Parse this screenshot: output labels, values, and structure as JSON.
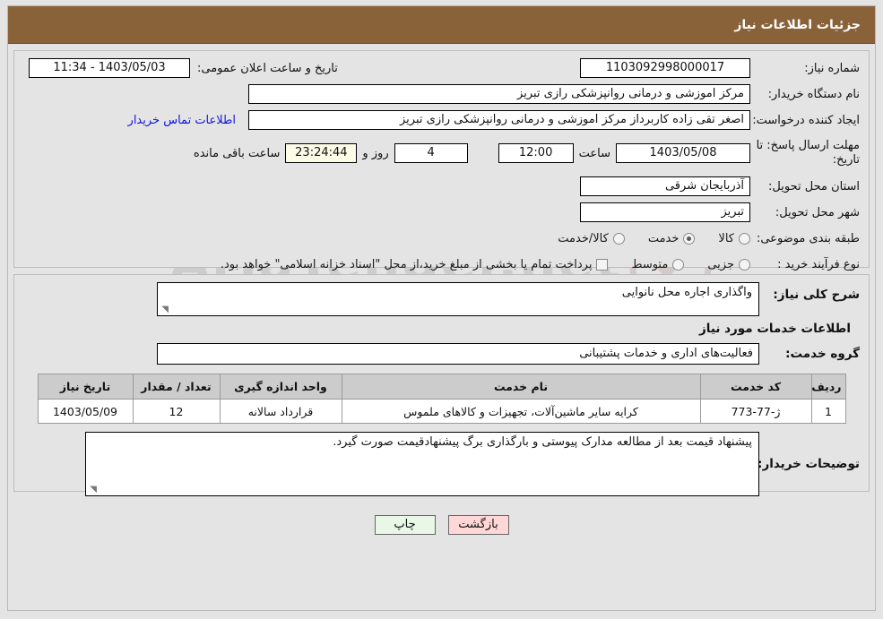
{
  "header": {
    "title": "جزئیات اطلاعات نیاز",
    "bar_color": "#8a6239"
  },
  "watermark": {
    "text": "AriaTender.net"
  },
  "top_panel": {
    "need_number_label": "شماره نیاز:",
    "need_number_value": "1103092998000017",
    "public_announce_label": "تاریخ و ساعت اعلان عمومی:",
    "public_announce_value": "11:34 - 1403/05/03",
    "buyer_org_label": "نام دستگاه خریدار:",
    "buyer_org_value": "مرکز اموزشی و درمانی روانپزشکی رازی تبریز",
    "creator_label": "ایجاد کننده درخواست:",
    "creator_value": "اصغر تقی زاده کاربرداز مرکز اموزشی و درمانی روانپزشکی رازی تبریز",
    "buyer_contact_link": "اطلاعات تماس خریدار",
    "deadline_label": "مهلت ارسال پاسخ: تا تاریخ:",
    "deadline_date": "1403/05/08",
    "deadline_hour_label": "ساعت",
    "deadline_hour": "12:00",
    "remaining_days": "4",
    "days_and_label": "روز و",
    "remaining_time": "23:24:44",
    "remaining_suffix": "ساعت باقی مانده",
    "province_label": "استان محل تحویل:",
    "province_value": "آذربایجان شرقی",
    "city_label": "شهر محل تحویل:",
    "city_value": "تبریز",
    "category_label": "طبقه بندی موضوعی:",
    "category_options": [
      {
        "label": "کالا",
        "selected": false
      },
      {
        "label": "خدمت",
        "selected": true
      },
      {
        "label": "کالا/خدمت",
        "selected": false
      }
    ],
    "process_label": "نوع فرآیند خرید :",
    "process_options": [
      {
        "label": "جزیی",
        "selected": false
      },
      {
        "label": "متوسط",
        "selected": false
      }
    ],
    "treasury_checkbox_label": "پرداخت تمام یا بخشی از مبلغ خرید،از محل \"اسناد خزانه اسلامی\" خواهد بود.",
    "treasury_checked": false
  },
  "mid_panel": {
    "general_desc_label": "شرح کلی نیاز:",
    "general_desc_value": "واگذاری اجاره محل نانوایی",
    "services_section_title": "اطلاعات خدمات مورد نیاز",
    "service_group_label": "گروه خدمت:",
    "service_group_value": "فعالیت‌های اداری و خدمات پشتیبانی",
    "table": {
      "headers": [
        "ردیف",
        "کد خدمت",
        "نام خدمت",
        "واحد اندازه گیری",
        "تعداد / مقدار",
        "تاریخ نیاز"
      ],
      "rows": [
        {
          "row": "1",
          "code": "ژ-77-773",
          "name": "کرایه سایر ماشین‌آلات، تجهیزات و کالاهای ملموس",
          "unit": "قرارداد سالانه",
          "qty": "12",
          "date": "1403/05/09"
        }
      ]
    },
    "buyer_notes_label": "توضیحات خریدار:",
    "buyer_notes_value": "پیشنهاد قیمت بعد از مطالعه مدارک پیوستی و بارگذاری برگ پیشنهادقیمت صورت گیرد."
  },
  "footer": {
    "back_button": "بازگشت",
    "print_button": "چاپ"
  }
}
